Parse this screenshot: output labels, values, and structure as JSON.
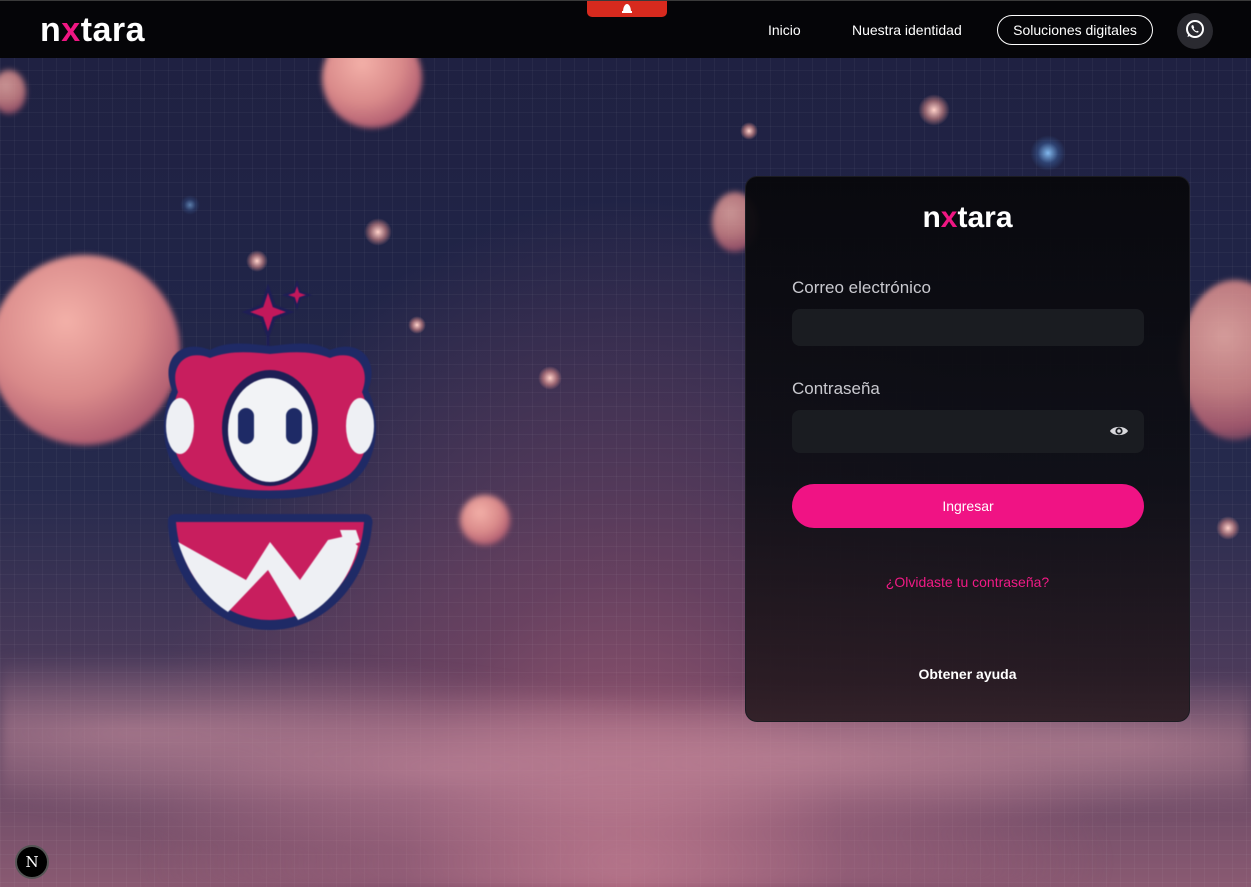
{
  "brand": {
    "logo_prefix": "n",
    "logo_x": "x",
    "logo_suffix": "tara",
    "accent_color": "#f01384"
  },
  "header": {
    "nav": [
      {
        "label": "Inicio"
      },
      {
        "label": "Nuestra identidad"
      },
      {
        "label": "Soluciones digitales"
      }
    ],
    "whatsapp_icon": "whatsapp-icon",
    "top_tab_icon": "hat-icon"
  },
  "login": {
    "email_label": "Correo electrónico",
    "email_value": "",
    "password_label": "Contraseña",
    "password_value": "",
    "password_toggle_icon": "eye-icon",
    "submit_label": "Ingresar",
    "forgot_label": "¿Olvidaste tu contraseña?",
    "help_label": "Obtener ayuda"
  },
  "dev_badge": {
    "label": "N"
  }
}
